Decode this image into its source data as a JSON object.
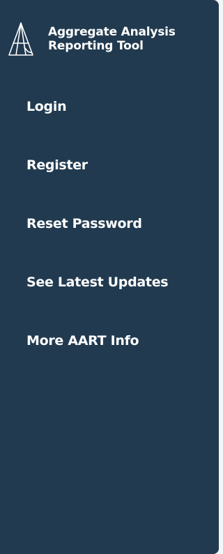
{
  "brand": {
    "title_line1": "Aggregate Analysis",
    "title_line2": "Reporting Tool",
    "logo_icon": "aart-pen-triangle-logo"
  },
  "nav": {
    "items": [
      {
        "label": "Login"
      },
      {
        "label": "Register"
      },
      {
        "label": "Reset Password"
      },
      {
        "label": "See Latest Updates"
      },
      {
        "label": "More AART Info"
      }
    ]
  },
  "colors": {
    "sidebar_bg": "#213a4f",
    "text": "#ffffff"
  }
}
